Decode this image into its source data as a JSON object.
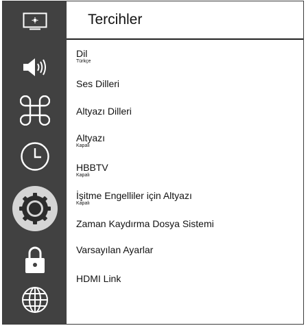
{
  "header": {
    "title": "Tercihler"
  },
  "sidebar": {
    "items": [
      {
        "icon": "tv-screen-icon"
      },
      {
        "icon": "speaker-icon"
      },
      {
        "icon": "command-icon"
      },
      {
        "icon": "clock-icon"
      },
      {
        "icon": "gear-icon",
        "active": true
      },
      {
        "icon": "lock-icon"
      },
      {
        "icon": "globe-icon"
      }
    ]
  },
  "menu": {
    "items": [
      {
        "label": "Dil",
        "value": "Türkçe"
      },
      {
        "label": "Ses Dilleri"
      },
      {
        "label": "Altyazı Dilleri"
      },
      {
        "label": "Altyazı",
        "value": "Kapalı"
      },
      {
        "label": "HBBTV",
        "value": "Kapalı"
      },
      {
        "label": "İşitme Engelliler için Altyazı",
        "value": "Kapalı"
      },
      {
        "label": "Zaman Kaydırma Dosya Sistemi"
      },
      {
        "label": "Varsayılan Ayarlar"
      },
      {
        "label": "HDMI Link"
      }
    ]
  },
  "colors": {
    "sidebar_bg": "#414141",
    "icon": "#ffffff",
    "active_ring": "#d5d5d5"
  }
}
